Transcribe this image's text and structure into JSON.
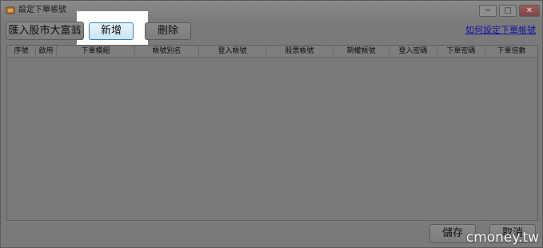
{
  "window": {
    "title": "設定下單帳號",
    "controls": [
      "─",
      "□",
      "✕"
    ]
  },
  "toolbar": {
    "import_label": "匯入股市大富翁",
    "add_label": "新增",
    "delete_label": "刪除",
    "help_link": "如何設定下單帳號"
  },
  "table": {
    "columns": [
      "序號",
      "啟用",
      "下單模組",
      "帳號別名",
      "登入帳號",
      "股票帳號",
      "期權帳號",
      "登入密碼",
      "下單密碼",
      "下單倍數"
    ],
    "rows": []
  },
  "footer": {
    "save_label": "儲存",
    "cancel_label": "取消"
  },
  "watermark": "cmoney.tw"
}
